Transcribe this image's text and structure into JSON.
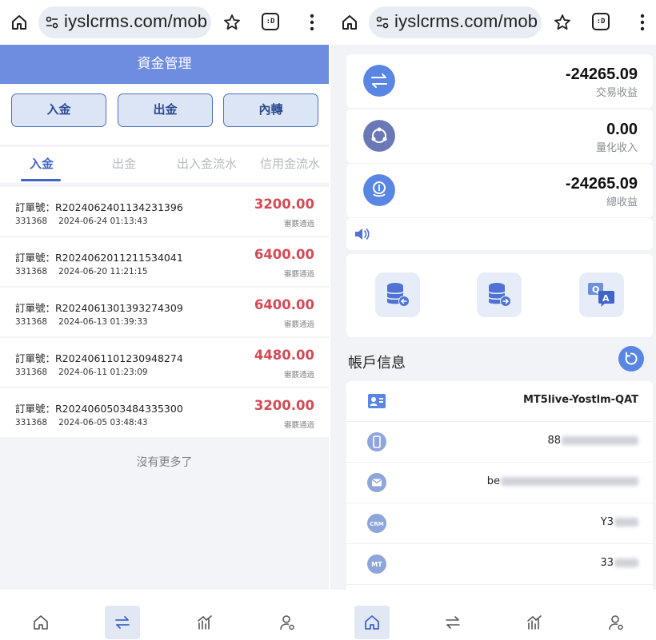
{
  "browser": {
    "url": "iyslcrms.com/mob",
    "tab_count_label": ":D"
  },
  "left": {
    "page_title": "資金管理",
    "buttons": {
      "deposit": "入金",
      "withdraw": "出金",
      "transfer": "內轉"
    },
    "tabs": [
      "入金",
      "出金",
      "出入金流水",
      "信用金流水"
    ],
    "orders": [
      {
        "order_no": "訂單號：R2024062401134231396",
        "account": "331368",
        "time": "2024-06-24 01:13:43",
        "amount": "3200.00",
        "status": "審覈通過"
      },
      {
        "order_no": "訂單號：R2024062011211534041",
        "account": "331368",
        "time": "2024-06-20 11:21:15",
        "amount": "6400.00",
        "status": "審覈通過"
      },
      {
        "order_no": "訂單號：R2024061301393274309",
        "account": "331368",
        "time": "2024-06-13 01:39:33",
        "amount": "6400.00",
        "status": "審覈通過"
      },
      {
        "order_no": "訂單號：R2024061101230948274",
        "account": "331368",
        "time": "2024-06-11 01:23:09",
        "amount": "4480.00",
        "status": "審覈通過"
      },
      {
        "order_no": "訂單號：R2024060503484335300",
        "account": "331368",
        "time": "2024-06-05 03:48:43",
        "amount": "3200.00",
        "status": "審覈通過"
      }
    ],
    "no_more": "沒有更多了"
  },
  "right": {
    "stats": [
      {
        "value": "-24265.09",
        "label": "交易收益",
        "icon": "transfer-arrows-icon"
      },
      {
        "value": "0.00",
        "label": "量化收入",
        "icon": "quant-hub-icon"
      },
      {
        "value": "-24265.09",
        "label": "總收益",
        "icon": "coins-icon"
      }
    ],
    "account_title": "帳戶信息",
    "account": {
      "platform": "MT5live-Yostlm-QAT",
      "phone_visible": "88",
      "email_visible": "be",
      "crm_visible": "Y3",
      "mt_visible": "33"
    }
  },
  "colors": {
    "primary": "#6f8de0",
    "accent": "#3f65c8",
    "amount_red": "#d44b55",
    "icon_blue": "#5a86e3"
  }
}
